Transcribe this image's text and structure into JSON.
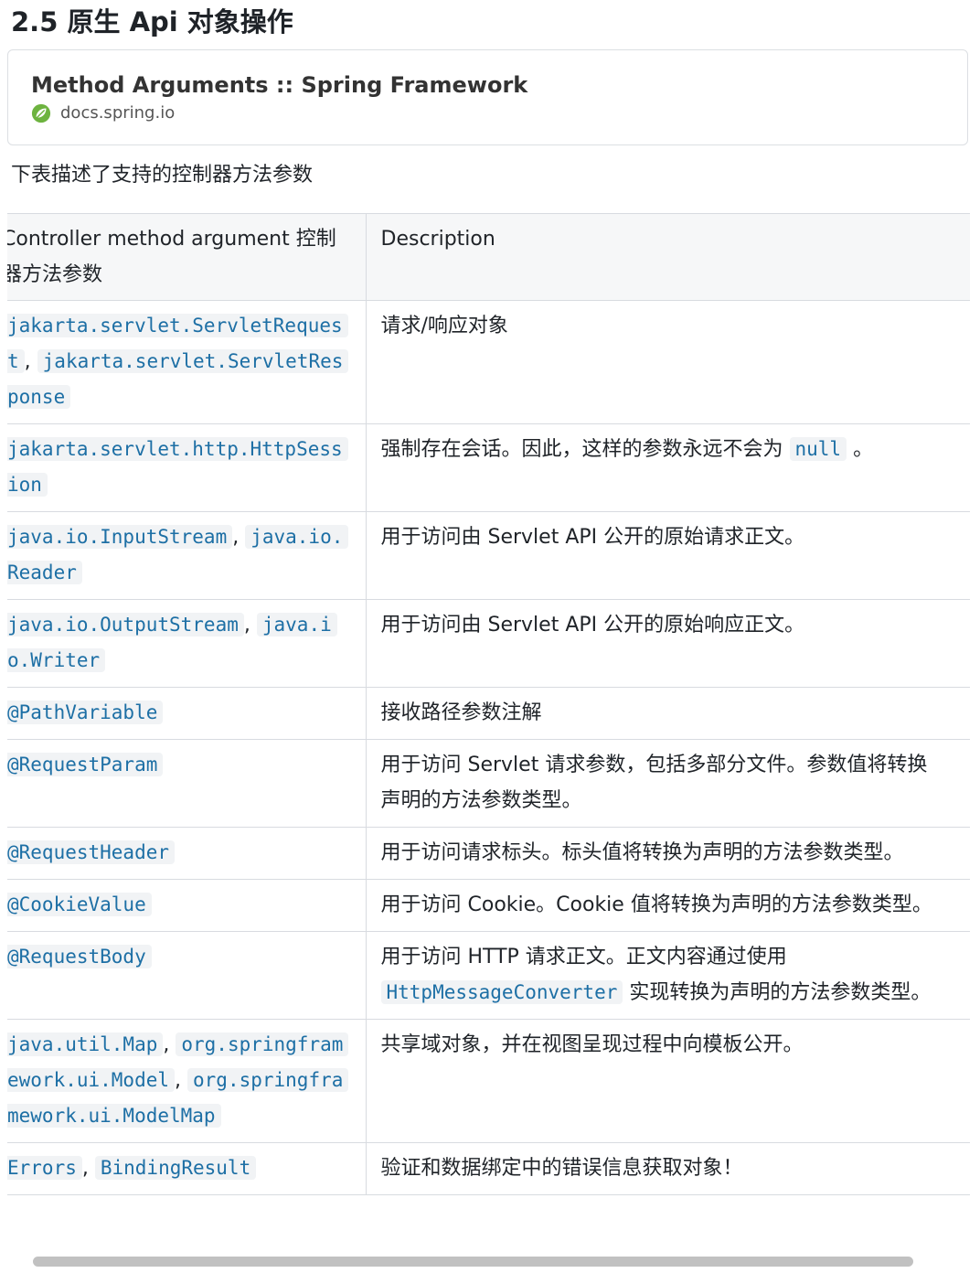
{
  "heading": "2.5 原生 Api 对象操作",
  "link_card": {
    "title": "Method Arguments :: Spring Framework",
    "source": "docs.spring.io",
    "icon": "spring-leaf-icon"
  },
  "intro": "下表描述了支持的控制器方法参数",
  "table": {
    "headers": [
      "Controller method argument 控制器方法参数",
      "Description"
    ],
    "rows": [
      {
        "codes": [
          "jakarta.servlet.ServletRequest",
          "jakarta.servlet.ServletResponse"
        ],
        "desc_parts": [
          "请求/响应对象"
        ]
      },
      {
        "codes": [
          "jakarta.servlet.http.HttpSession"
        ],
        "desc_parts": [
          "强制存在会话。因此，这样的参数永远不会为 ",
          "null",
          " 。"
        ]
      },
      {
        "codes": [
          "java.io.InputStream",
          "java.io.Reader"
        ],
        "desc_parts": [
          " 用于访问由 Servlet API 公开的原始请求正文。"
        ]
      },
      {
        "codes": [
          "java.io.OutputStream",
          "java.io.Writer"
        ],
        "desc_parts": [
          "用于访问由 Servlet API 公开的原始响应正文。"
        ]
      },
      {
        "codes": [
          "@PathVariable"
        ],
        "desc_parts": [
          "接收路径参数注解"
        ]
      },
      {
        "codes": [
          "@RequestParam"
        ],
        "desc_parts": [
          "用于访问 Servlet 请求参数，包括多部分文件。参数值将转换",
          "声明的方法参数类型。"
        ]
      },
      {
        "codes": [
          "@RequestHeader"
        ],
        "desc_parts": [
          "用于访问请求标头。标头值将转换为声明的方法参数类型。"
        ]
      },
      {
        "codes": [
          "@CookieValue"
        ],
        "desc_parts": [
          "用于访问 Cookie。Cookie 值将转换为声明的方法参数类型。"
        ]
      },
      {
        "codes": [
          "@RequestBody"
        ],
        "desc_parts": [
          "用于访问 HTTP 请求正文。正文内容通过使用",
          "HttpMessageConverter",
          " 实现转换为声明的方法参数类型。"
        ]
      },
      {
        "codes": [
          "java.util.Map",
          "org.springframework.ui.Model",
          "org.springframework.ui.ModelMap"
        ],
        "desc_parts": [
          "共享域对象，并在视图呈现过程中向模板公开。"
        ]
      },
      {
        "codes": [
          "Errors",
          "BindingResult"
        ],
        "desc_parts": [
          "验证和数据绑定中的错误信息获取对象！"
        ]
      }
    ]
  },
  "scrollbar": {
    "visible_fraction": 0.9
  }
}
